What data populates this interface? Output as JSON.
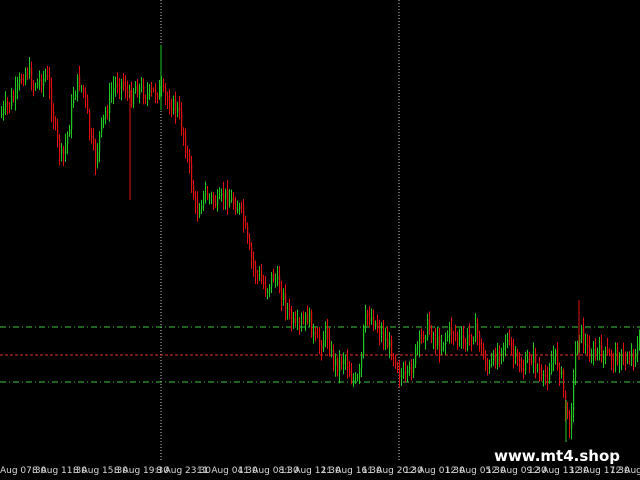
{
  "watermark": "www.mt4.shop",
  "colors": {
    "background": "#000000",
    "bull_candle": "#22c822",
    "bear_candle": "#e01010",
    "session_separator": "#c8c8c8",
    "level_line": "#3fc63f",
    "mid_line": "#e83030",
    "axis_text": "#d8d8d8"
  },
  "time_axis": {
    "labels": [
      "Aug 07:30",
      "8 Aug 11:30",
      "8 Aug 15:30",
      "8 Aug 19:30",
      "8 Aug 23:30",
      "11 Aug 04:30",
      "11 Aug 08:30",
      "11 Aug 12:30",
      "11 Aug 16:30",
      "11 Aug 20:30",
      "12 Aug 01:30",
      "12 Aug 05:30",
      "12 Aug 09:30",
      "12 Aug 13:30",
      "12 Aug 17:30",
      "12 Aug 21:"
    ]
  },
  "indicator_lines": {
    "upper_level": "dash-dot",
    "middle_level": "dashed",
    "lower_level": "dash-dot"
  }
}
